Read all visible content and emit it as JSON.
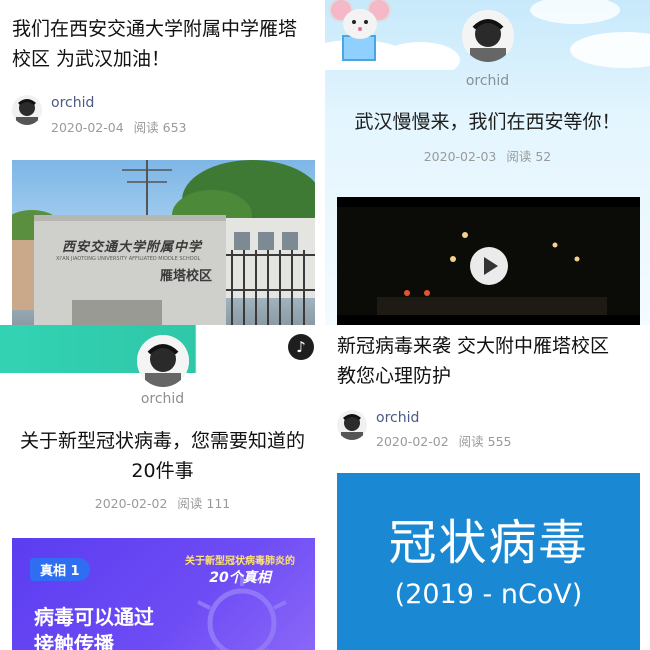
{
  "cards": [
    {
      "title_line1": "我们在西安交通大学附属中学雁塔",
      "title_line2": "校区 为武汉加油！",
      "author": "orchid",
      "date": "2020-02-04",
      "reads": "阅读 653",
      "sign_top": "西安交通大学附属中学",
      "sign_mid": "XI'AN JIAOTONG UNIVERSITY AFFILIATED MIDDLE SCHOOL",
      "sign_bot": "雁塔校区"
    },
    {
      "title": "武汉慢慢来，我们在西安等你！",
      "author": "orchid",
      "date": "2020-02-03",
      "reads": "阅读 52"
    },
    {
      "title_line1": "关于新型冠状病毒，您需要知道的",
      "title_line2": "20件事",
      "author": "orchid",
      "date": "2020-02-02",
      "reads": "阅读 111",
      "banner_tag": "真相 1",
      "banner_head_small": "关于新型冠状病毒肺炎的",
      "banner_head_big": "20个真相",
      "banner_line1": "病毒可以通过",
      "banner_line2": "接触传播"
    },
    {
      "title_line1": "新冠病毒来袭 交大附中雁塔校区",
      "title_line2": "教您心理防护",
      "author": "orchid",
      "date": "2020-02-02",
      "reads": "阅读 555",
      "cover_title": "冠状病毒",
      "cover_sub": "(2019 - nCoV)"
    }
  ],
  "colors": {
    "author": "#4a5a82",
    "meta": "#9a9a9a",
    "cover_blue": "#1a88d3",
    "banner_purple": "#5b3df0",
    "mint": "#32d3b3"
  }
}
